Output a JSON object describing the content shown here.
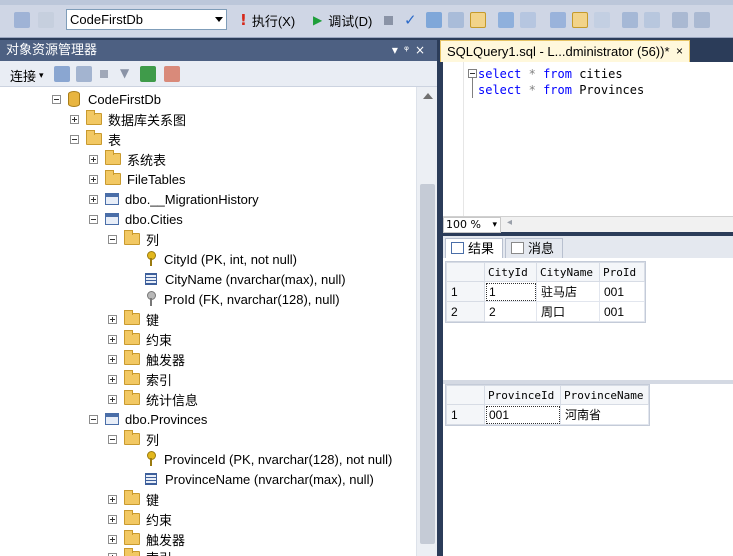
{
  "toolbar": {
    "database": "CodeFirstDb",
    "execute_label": "执行(X)",
    "debug_label": "调试(D)"
  },
  "object_explorer": {
    "title": "对象资源管理器",
    "connect_label": "连接",
    "tree": [
      {
        "label": "CodeFirstDb",
        "icon": "database-icon",
        "expander": "minus"
      },
      {
        "label": "数据库关系图",
        "icon": "folder-icon",
        "expander": "plus"
      },
      {
        "label": "表",
        "icon": "folder-icon",
        "expander": "minus"
      },
      {
        "label": "系统表",
        "icon": "folder-icon",
        "expander": "plus"
      },
      {
        "label": "FileTables",
        "icon": "folder-icon",
        "expander": "plus"
      },
      {
        "label": "dbo.__MigrationHistory",
        "icon": "table-icon",
        "expander": "plus"
      },
      {
        "label": "dbo.Cities",
        "icon": "table-icon",
        "expander": "minus"
      },
      {
        "label": "列",
        "icon": "folder-icon",
        "expander": "minus"
      },
      {
        "label": "CityId (PK, int, not null)",
        "icon": "primary-key-icon",
        "expander": "none"
      },
      {
        "label": "CityName (nvarchar(max), null)",
        "icon": "column-icon",
        "expander": "none"
      },
      {
        "label": "ProId (FK, nvarchar(128), null)",
        "icon": "foreign-key-icon",
        "expander": "none"
      },
      {
        "label": "键",
        "icon": "folder-icon",
        "expander": "plus"
      },
      {
        "label": "约束",
        "icon": "folder-icon",
        "expander": "plus"
      },
      {
        "label": "触发器",
        "icon": "folder-icon",
        "expander": "plus"
      },
      {
        "label": "索引",
        "icon": "folder-icon",
        "expander": "plus"
      },
      {
        "label": "统计信息",
        "icon": "folder-icon",
        "expander": "plus"
      },
      {
        "label": "dbo.Provinces",
        "icon": "table-icon",
        "expander": "minus"
      },
      {
        "label": "列",
        "icon": "folder-icon",
        "expander": "minus"
      },
      {
        "label": "ProvinceId (PK, nvarchar(128), not null)",
        "icon": "primary-key-icon",
        "expander": "none"
      },
      {
        "label": "ProvinceName (nvarchar(max), null)",
        "icon": "column-icon",
        "expander": "none"
      },
      {
        "label": "键",
        "icon": "folder-icon",
        "expander": "plus"
      },
      {
        "label": "约束",
        "icon": "folder-icon",
        "expander": "plus"
      },
      {
        "label": "触发器",
        "icon": "folder-icon",
        "expander": "plus"
      },
      {
        "label": "索引",
        "icon": "folder-icon",
        "expander": "plus"
      }
    ]
  },
  "query": {
    "tab_title": "SQLQuery1.sql - L...dministrator (56))*",
    "code": [
      {
        "kw1": "select",
        "op": "*",
        "kw2": "from",
        "table": "cities"
      },
      {
        "kw1": "select",
        "op": "*",
        "kw2": "from",
        "table": "Provinces"
      }
    ],
    "zoom": "100 %"
  },
  "results": {
    "tab_results": "结果",
    "tab_messages": "消息",
    "grids": [
      {
        "columns": [
          "CityId",
          "CityName",
          "ProId"
        ],
        "rows": [
          {
            "num": "1",
            "cells": [
              "1",
              "驻马店",
              "001"
            ]
          },
          {
            "num": "2",
            "cells": [
              "2",
              "周口",
              "001"
            ]
          }
        ]
      },
      {
        "columns": [
          "ProvinceId",
          "ProvinceName"
        ],
        "rows": [
          {
            "num": "1",
            "cells": [
              "001",
              "河南省"
            ]
          }
        ]
      }
    ]
  }
}
